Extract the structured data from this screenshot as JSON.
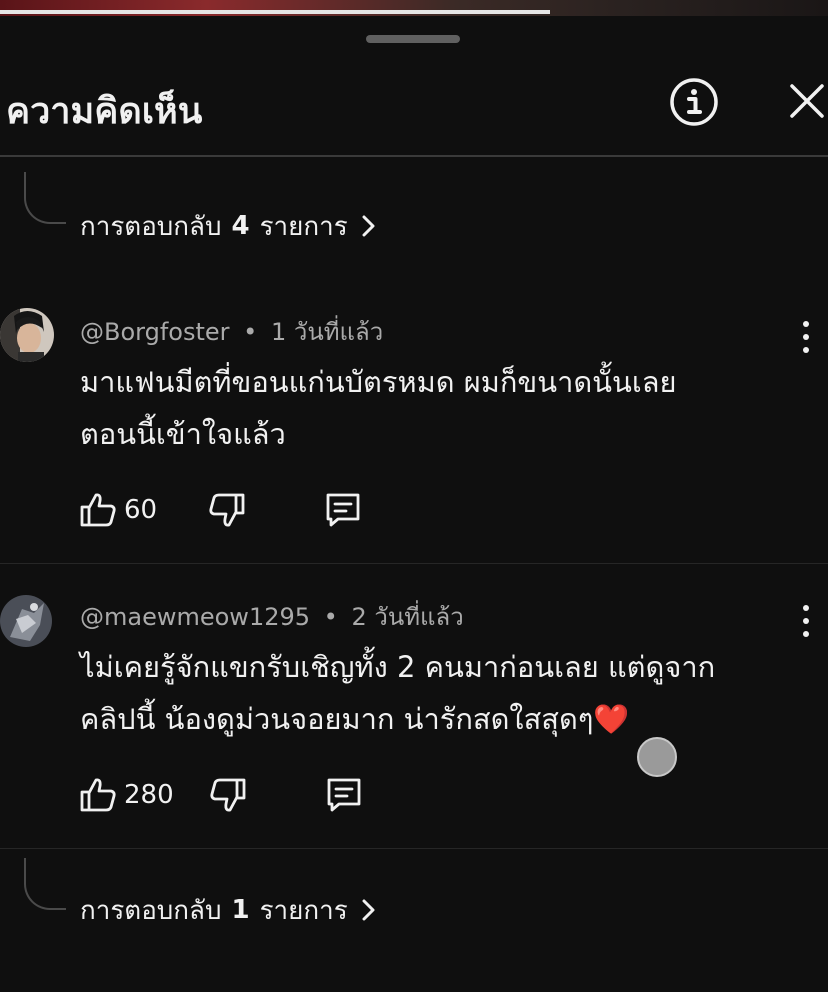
{
  "panel": {
    "title": "ความคิดเห็น"
  },
  "reply_link_top": {
    "prefix": "การตอบกลับ",
    "count": "4",
    "suffix": "รายการ"
  },
  "comments": [
    {
      "author": "@Borgfoster",
      "separator": "•",
      "time": "1 วันที่แล้ว",
      "lines": [
        "มาแฟนมีตที่ขอนแก่นบัตรหมด ผมก็ขนาดนั้นเลย",
        "ตอนนี้เข้าใจแล้ว"
      ],
      "likes": "60"
    },
    {
      "author": "@maewmeow1295",
      "separator": "•",
      "time": "2 วันที่แล้ว",
      "lines": [
        "ไม่เคยรู้จักแขกรับเชิญทั้ง 2 คนมาก่อนเลย แต่ดูจาก",
        "คลิปนี้ น้องดูม่วนจอยมาก น่ารักสดใสสุดๆ❤️"
      ],
      "likes": "280"
    }
  ],
  "reply_link_bottom": {
    "prefix": "การตอบกลับ",
    "count": "1",
    "suffix": "รายการ"
  },
  "icons": [
    "info-icon",
    "close-icon",
    "like-icon",
    "dislike-icon",
    "reply-icon",
    "more-vert-icon",
    "chevron-right-icon"
  ],
  "colors": {
    "background": "#0f0f0f",
    "text": "#f1f1f1",
    "secondary": "#aaaaaa",
    "heart": "#e63950"
  }
}
